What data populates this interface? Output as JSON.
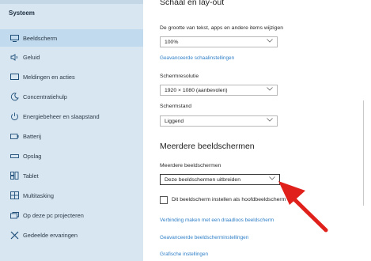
{
  "colors": {
    "sidebar_bg": "#d7e6f1",
    "link": "#2f7fc7",
    "arrow": "#e0201b"
  },
  "sidebar": {
    "section_title": "Systeem",
    "items": [
      {
        "label": "Beeldscherm",
        "icon": "monitor-icon"
      },
      {
        "label": "Geluid",
        "icon": "speaker-icon"
      },
      {
        "label": "Meldingen en acties",
        "icon": "notification-icon"
      },
      {
        "label": "Concentratiehulp",
        "icon": "moon-icon"
      },
      {
        "label": "Energiebeheer en slaapstand",
        "icon": "power-icon"
      },
      {
        "label": "Batterij",
        "icon": "battery-icon"
      },
      {
        "label": "Opslag",
        "icon": "storage-icon"
      },
      {
        "label": "Tablet",
        "icon": "tablet-icon"
      },
      {
        "label": "Multitasking",
        "icon": "multitasking-icon"
      },
      {
        "label": "Op deze pc projecteren",
        "icon": "project-icon"
      },
      {
        "label": "Gedeelde ervaringen",
        "icon": "share-icon"
      }
    ]
  },
  "main": {
    "scale_heading": "Schaal en lay-out",
    "scale_label": "De grootte van tekst, apps en andere items wijzigen",
    "scale_value": "100%",
    "advanced_scaling_link": "Geavanceerde schaalinstellingen",
    "resolution_label": "Schermresolutie",
    "resolution_value": "1920 × 1080 (aanbevolen)",
    "orientation_label": "Schermstand",
    "orientation_value": "Liggend",
    "multi_heading": "Meerdere beeldschermen",
    "multi_label": "Meerdere beeldschermen",
    "multi_value": "Deze beeldschermen uitbreiden",
    "main_display_checkbox": "Dit beeldscherm instellen als hoofdbeeldscherm",
    "wireless_link": "Verbinding maken met een draadloos beeldscherm",
    "advanced_display_link": "Geavanceerde beeldscherminstellingen",
    "graphics_link": "Grafische instellingen"
  }
}
